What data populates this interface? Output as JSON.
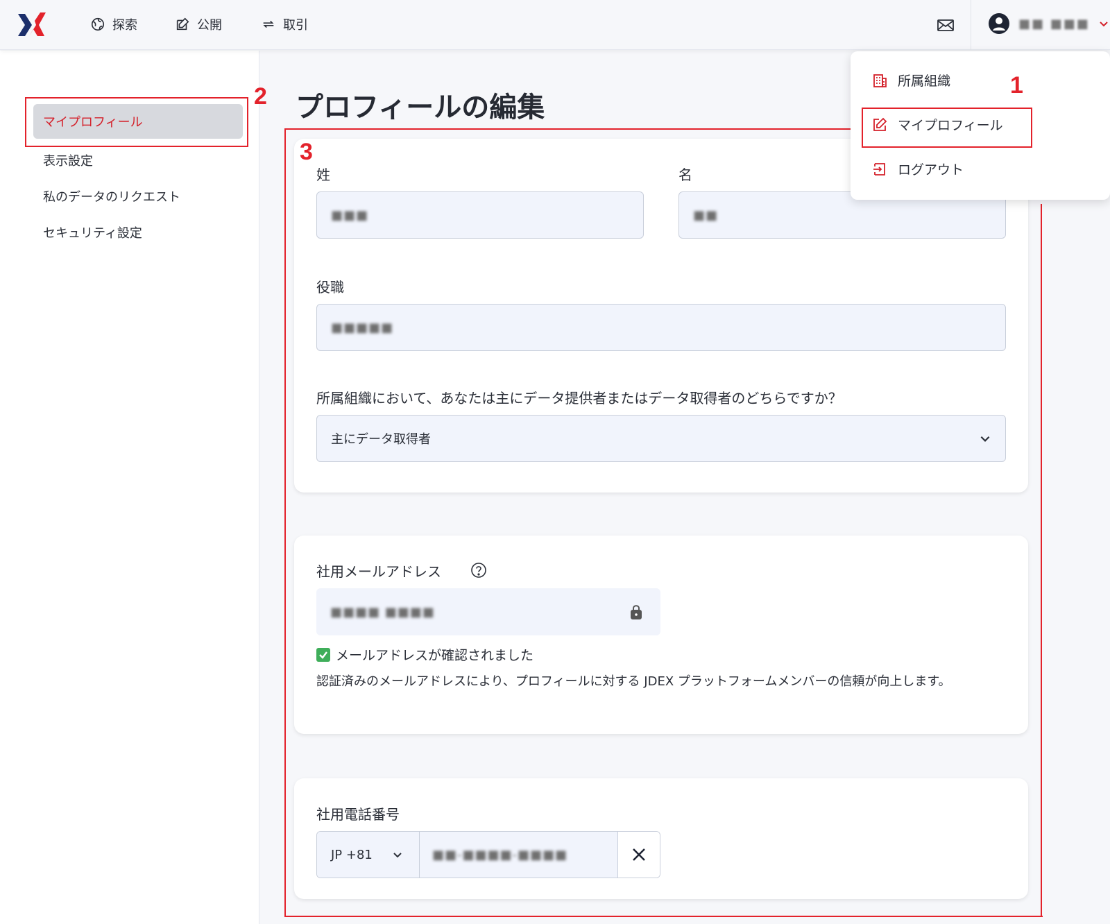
{
  "nav": {
    "explore": "探索",
    "publish": "公開",
    "deals": "取引",
    "user_name": "■■ ■■■"
  },
  "dropdown": {
    "org": "所属組織",
    "profile": "マイプロフィール",
    "logout": "ログアウト"
  },
  "sidebar": {
    "items": [
      "マイプロフィール",
      "表示設定",
      "私のデータのリクエスト",
      "セキュリティ設定"
    ]
  },
  "annotations": [
    "1",
    "2",
    "3"
  ],
  "main": {
    "title": "プロフィールの編集",
    "last_name_label": "姓",
    "last_name_value": "■■■",
    "first_name_label": "名",
    "first_name_value": "■■",
    "job_title_label": "役職",
    "job_title_value": "■■■■■",
    "role_question": "所属組織において、あなたは主にデータ提供者またはデータ取得者のどちらですか？",
    "role_value": "主にデータ取得者",
    "email_label": "社用メールアドレス",
    "email_value": "■■■■ ■■■■",
    "email_verified": "メールアドレスが確認されました",
    "email_desc": "認証済みのメールアドレスにより、プロフィールに対する JDEX プラットフォームメンバーの信頼が向上します。",
    "phone_label": "社用電話番号",
    "phone_cc": "JP +81",
    "phone_value": "■■-■■■■-■■■■"
  },
  "colors": {
    "accent_red": "#d4202a",
    "verified_green": "#3fae5a"
  }
}
